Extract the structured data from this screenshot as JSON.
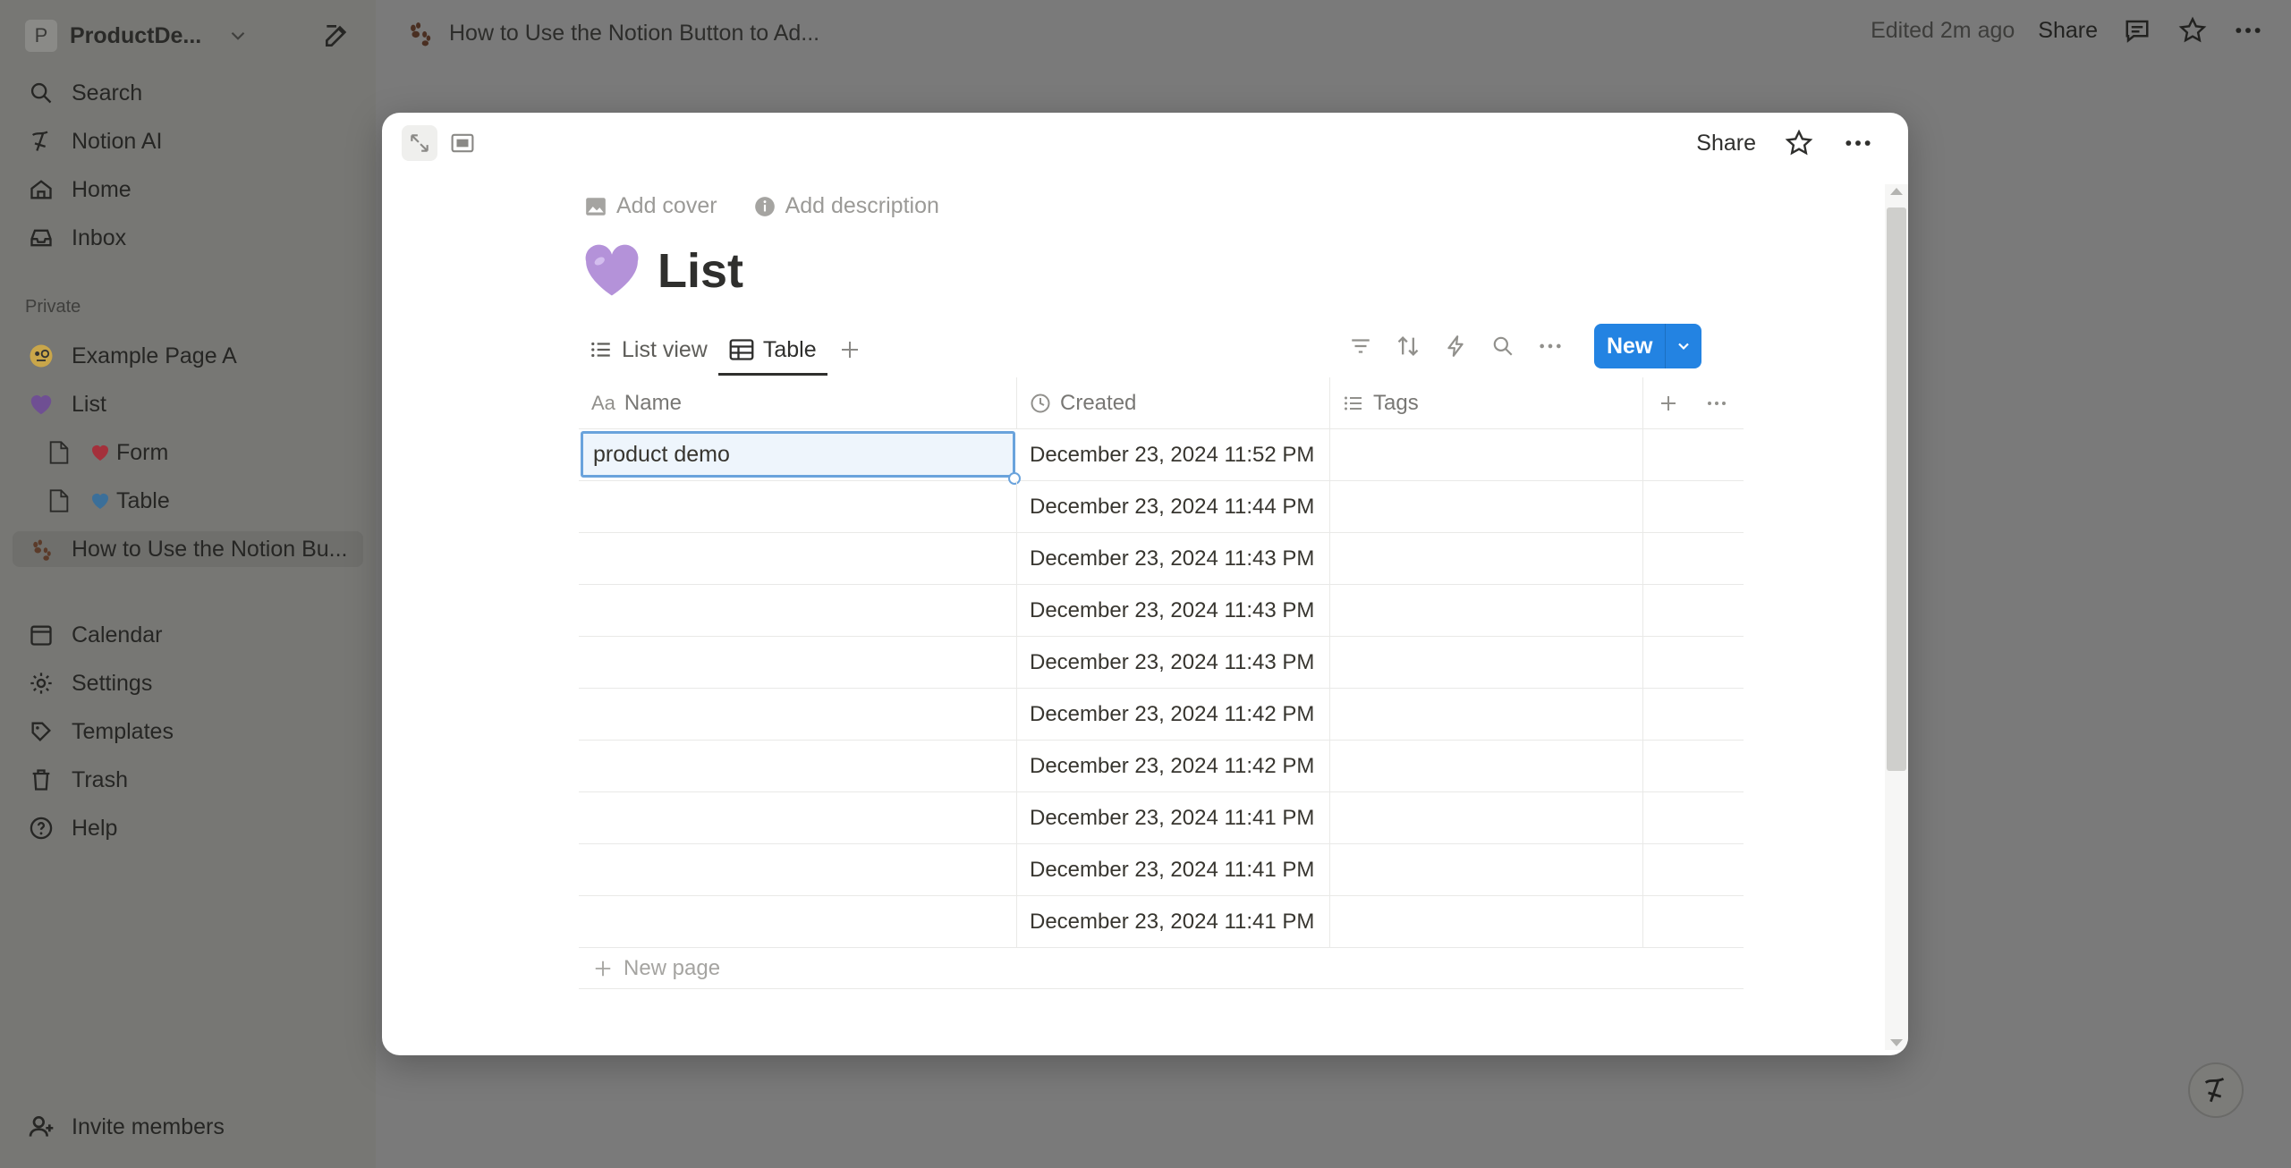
{
  "sidebar": {
    "workspace_badge": "P",
    "workspace_name": "ProductDe...",
    "top_items": [
      {
        "label": "Search",
        "icon": "search-icon"
      },
      {
        "label": "Notion AI",
        "icon": "notion-ai-icon"
      },
      {
        "label": "Home",
        "icon": "home-icon"
      },
      {
        "label": "Inbox",
        "icon": "inbox-icon"
      }
    ],
    "private_label": "Private",
    "pages": [
      {
        "label": "Example Page A",
        "icon": "monocle-face-emoji"
      },
      {
        "label": "List",
        "icon": "purple-heart-emoji"
      },
      {
        "label": "Form",
        "icon": "heart-emoji"
      },
      {
        "label": "Table",
        "icon": "blue-heart-emoji"
      },
      {
        "label": "How to Use the Notion Bu...",
        "icon": "paw-prints-emoji"
      }
    ],
    "bottom_items": [
      {
        "label": "Calendar",
        "icon": "calendar-icon"
      },
      {
        "label": "Settings",
        "icon": "gear-icon"
      },
      {
        "label": "Templates",
        "icon": "templates-icon"
      },
      {
        "label": "Trash",
        "icon": "trash-icon"
      },
      {
        "label": "Help",
        "icon": "help-icon"
      }
    ],
    "invite_label": "Invite members"
  },
  "topbar": {
    "page_title": "How to Use the Notion Button to Ad...",
    "edited": "Edited 2m ago",
    "share": "Share"
  },
  "modal": {
    "share": "Share",
    "add_cover": "Add cover",
    "add_description": "Add description",
    "title": "List",
    "tabs": [
      {
        "label": "List view",
        "selected": false
      },
      {
        "label": "Table",
        "selected": true
      }
    ],
    "new_button": "New",
    "columns": {
      "name": "Name",
      "created": "Created",
      "tags": "Tags"
    },
    "rows": [
      {
        "name": "product demo",
        "created": "December 23, 2024 11:52 PM",
        "tags": ""
      },
      {
        "name": "",
        "created": "December 23, 2024 11:44 PM",
        "tags": ""
      },
      {
        "name": "",
        "created": "December 23, 2024 11:43 PM",
        "tags": ""
      },
      {
        "name": "",
        "created": "December 23, 2024 11:43 PM",
        "tags": ""
      },
      {
        "name": "",
        "created": "December 23, 2024 11:43 PM",
        "tags": ""
      },
      {
        "name": "",
        "created": "December 23, 2024 11:42 PM",
        "tags": ""
      },
      {
        "name": "",
        "created": "December 23, 2024 11:42 PM",
        "tags": ""
      },
      {
        "name": "",
        "created": "December 23, 2024 11:41 PM",
        "tags": ""
      },
      {
        "name": "",
        "created": "December 23, 2024 11:41 PM",
        "tags": ""
      },
      {
        "name": "",
        "created": "December 23, 2024 11:41 PM",
        "tags": ""
      }
    ],
    "new_page": "New page"
  },
  "colors": {
    "accent": "#2383e2",
    "overlay": "#7a7a7a",
    "selection": "#6aa3dc"
  }
}
